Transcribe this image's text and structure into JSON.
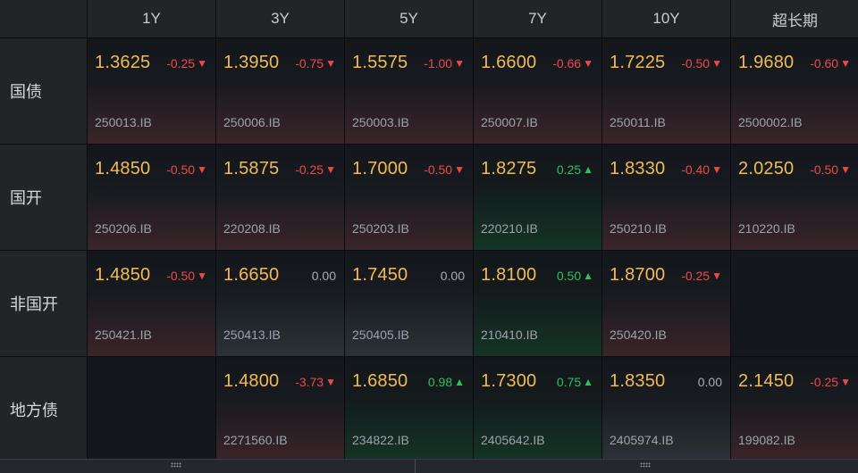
{
  "header": {
    "tenors": [
      "1Y",
      "3Y",
      "5Y",
      "7Y",
      "10Y",
      "超长期"
    ]
  },
  "rows": [
    {
      "label": "国债",
      "cells": [
        {
          "rate": "1.3625",
          "change": "-0.25",
          "dir": "neg",
          "code": "250013.IB"
        },
        {
          "rate": "1.3950",
          "change": "-0.75",
          "dir": "neg",
          "code": "250006.IB"
        },
        {
          "rate": "1.5575",
          "change": "-1.00",
          "dir": "neg",
          "code": "250003.IB"
        },
        {
          "rate": "1.6600",
          "change": "-0.66",
          "dir": "neg",
          "code": "250007.IB"
        },
        {
          "rate": "1.7225",
          "change": "-0.50",
          "dir": "neg",
          "code": "250011.IB"
        },
        {
          "rate": "1.9680",
          "change": "-0.60",
          "dir": "neg",
          "code": "2500002.IB"
        }
      ]
    },
    {
      "label": "国开",
      "cells": [
        {
          "rate": "1.4850",
          "change": "-0.50",
          "dir": "neg",
          "code": "250206.IB"
        },
        {
          "rate": "1.5875",
          "change": "-0.25",
          "dir": "neg",
          "code": "220208.IB"
        },
        {
          "rate": "1.7000",
          "change": "-0.50",
          "dir": "neg",
          "code": "250203.IB"
        },
        {
          "rate": "1.8275",
          "change": "0.25",
          "dir": "pos",
          "code": "220210.IB"
        },
        {
          "rate": "1.8330",
          "change": "-0.40",
          "dir": "neg",
          "code": "250210.IB"
        },
        {
          "rate": "2.0250",
          "change": "-0.50",
          "dir": "neg",
          "code": "210220.IB"
        }
      ]
    },
    {
      "label": "非国开",
      "cells": [
        {
          "rate": "1.4850",
          "change": "-0.50",
          "dir": "neg",
          "code": "250421.IB"
        },
        {
          "rate": "1.6650",
          "change": "0.00",
          "dir": "flat",
          "code": "250413.IB"
        },
        {
          "rate": "1.7450",
          "change": "0.00",
          "dir": "flat",
          "code": "250405.IB"
        },
        {
          "rate": "1.8100",
          "change": "0.50",
          "dir": "pos",
          "code": "210410.IB"
        },
        {
          "rate": "1.8700",
          "change": "-0.25",
          "dir": "neg",
          "code": "250420.IB"
        },
        null
      ]
    },
    {
      "label": "地方债",
      "cells": [
        null,
        {
          "rate": "1.4800",
          "change": "-3.73",
          "dir": "neg",
          "code": "2271560.IB"
        },
        {
          "rate": "1.6850",
          "change": "0.98",
          "dir": "pos",
          "code": "234822.IB"
        },
        {
          "rate": "1.7300",
          "change": "0.75",
          "dir": "pos",
          "code": "2405642.IB"
        },
        {
          "rate": "1.8350",
          "change": "0.00",
          "dir": "flat",
          "code": "2405974.IB"
        },
        {
          "rate": "2.1450",
          "change": "-0.25",
          "dir": "neg",
          "code": "199082.IB"
        }
      ]
    }
  ],
  "colors": {
    "rate": "#f2bb55",
    "down": "#ee4a4a",
    "up": "#2fc15c",
    "flat": "#a9adb3"
  },
  "icons": {
    "down": "triangle-down-icon",
    "up": "triangle-up-icon"
  }
}
